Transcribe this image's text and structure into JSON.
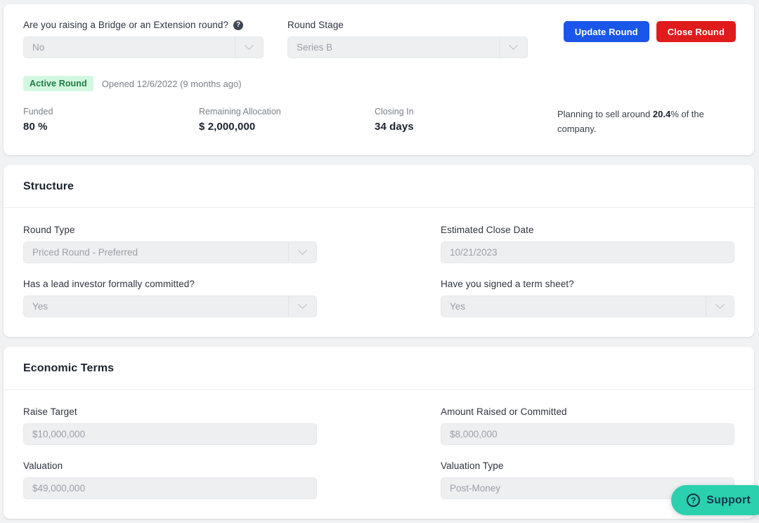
{
  "header": {
    "bridge_question": {
      "label": "Are you raising a Bridge or an Extension round?",
      "help_icon": "help-circle-icon",
      "value": "No"
    },
    "round_stage": {
      "label": "Round Stage",
      "value": "Series B"
    },
    "buttons": {
      "update": "Update Round",
      "close": "Close Round"
    },
    "status": {
      "badge": "Active Round",
      "opened_text": "Opened 12/6/2022  (9 months ago)"
    },
    "stats": [
      {
        "label": "Funded",
        "value": "80 %"
      },
      {
        "label": "Remaining Allocation",
        "value": "$ 2,000,000"
      },
      {
        "label": "Closing In",
        "value": "34 days"
      }
    ],
    "note": {
      "prefix": "Planning to sell around ",
      "highlight": "20.4",
      "suffix": "% of the company."
    }
  },
  "structure": {
    "title": "Structure",
    "fields": [
      {
        "label": "Round Type",
        "value": "Priced Round - Preferred",
        "type": "select"
      },
      {
        "label": "Estimated Close Date",
        "value": "10/21/2023",
        "type": "input"
      },
      {
        "label": "Has a lead investor formally committed?",
        "value": "Yes",
        "type": "select"
      },
      {
        "label": "Have you signed a term sheet?",
        "value": "Yes",
        "type": "select"
      }
    ]
  },
  "economic_terms": {
    "title": "Economic Terms",
    "fields": [
      {
        "label": "Raise Target",
        "value": "$10,000,000",
        "type": "input"
      },
      {
        "label": "Amount Raised or Committed",
        "value": "$8,000,000",
        "type": "input"
      },
      {
        "label": "Valuation",
        "value": "$49,000,000",
        "type": "input"
      },
      {
        "label": "Valuation Type",
        "value": "Post-Money",
        "type": "input"
      }
    ]
  },
  "support": {
    "label": "Support",
    "icon": "help-circle-icon",
    "glyph": "?"
  },
  "colors": {
    "page_bg": "#f1f2f4",
    "card_bg": "#ffffff",
    "primary_button": "#1a56e8",
    "danger_button": "#e01b1b",
    "badge_bg": "#d3f8e0",
    "badge_text": "#1d7a44",
    "support_bg": "#2bd1ae",
    "field_bg": "#eeeff1"
  }
}
